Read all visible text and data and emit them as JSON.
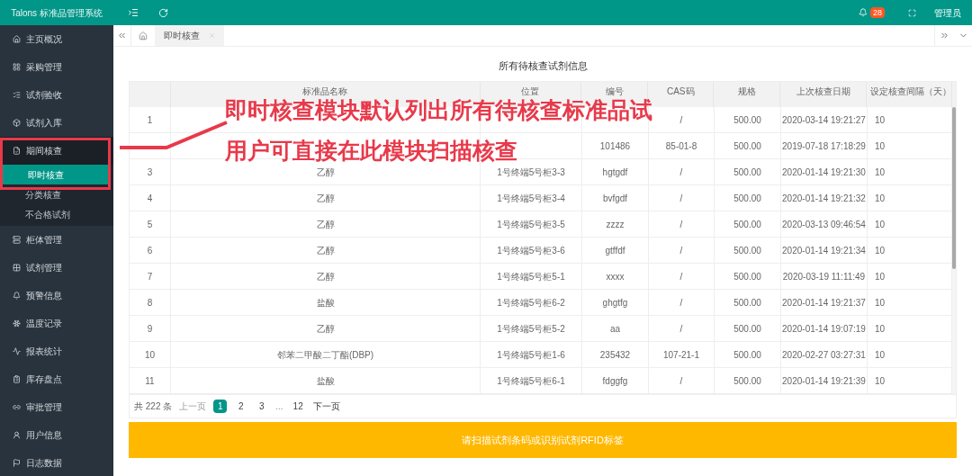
{
  "app_title": "Talons 标准品管理系统",
  "notifications": {
    "count": "28"
  },
  "user": "管理员",
  "sidebar": {
    "items": [
      {
        "label": "主页概况",
        "expanded": false
      },
      {
        "label": "采购管理",
        "expanded": false
      },
      {
        "label": "试剂验收",
        "expanded": false
      },
      {
        "label": "试剂入库",
        "expanded": false
      },
      {
        "label": "期间核查",
        "expanded": true,
        "children": [
          {
            "label": "即时核查",
            "selected": true
          },
          {
            "label": "分类核查",
            "selected": false
          },
          {
            "label": "不合格试剂",
            "selected": false
          }
        ]
      },
      {
        "label": "柜体管理",
        "expanded": false
      },
      {
        "label": "试剂管理",
        "expanded": false
      },
      {
        "label": "预警信息",
        "expanded": false
      },
      {
        "label": "温度记录",
        "expanded": false
      },
      {
        "label": "报表统计",
        "expanded": false
      },
      {
        "label": "库存盘点",
        "expanded": false
      },
      {
        "label": "审批管理",
        "expanded": false
      },
      {
        "label": "用户信息",
        "expanded": false
      },
      {
        "label": "日志数据",
        "expanded": false
      }
    ]
  },
  "tabs": [
    {
      "label": "即时核查",
      "selected": true
    }
  ],
  "page_title": "所有待核查试剂信息",
  "table": {
    "columns": [
      null,
      "标准品名称",
      "位置",
      "编号",
      "CAS码",
      "规格",
      "上次核查日期",
      "设定核查间隔（天）"
    ],
    "rows": [
      [
        "1",
        null,
        null,
        null,
        "/",
        "500.00",
        "2020-03-14 19:21:27",
        "10"
      ],
      [
        null,
        null,
        null,
        "101486",
        "85-01-8",
        "500.00",
        "2019-07-18 17:18:29",
        "10"
      ],
      [
        "3",
        "乙醇",
        "1号终端5号柜3-3",
        "hgtgdf",
        "/",
        "500.00",
        "2020-01-14 19:21:30",
        "10"
      ],
      [
        "4",
        "乙醇",
        "1号终端5号柜3-4",
        "bvfgdf",
        "/",
        "500.00",
        "2020-01-14 19:21:32",
        "10"
      ],
      [
        "5",
        "乙醇",
        "1号终端5号柜3-5",
        "zzzz",
        "/",
        "500.00",
        "2020-03-13 09:46:54",
        "10"
      ],
      [
        "6",
        "乙醇",
        "1号终端5号柜3-6",
        "gtffdf",
        "/",
        "500.00",
        "2020-01-14 19:21:34",
        "10"
      ],
      [
        "7",
        "乙醇",
        "1号终端5号柜5-1",
        "xxxx",
        "/",
        "500.00",
        "2020-03-19 11:11:49",
        "10"
      ],
      [
        "8",
        "盐酸",
        "1号终端5号柜6-2",
        "ghgtfg",
        "/",
        "500.00",
        "2020-01-14 19:21:37",
        "10"
      ],
      [
        "9",
        "乙醇",
        "1号终端5号柜5-2",
        "aa",
        "/",
        "500.00",
        "2020-01-14 19:07:19",
        "10"
      ],
      [
        "10",
        "邻苯二甲酸二丁酯(DBP)",
        "1号终端5号柜1-6",
        "235432",
        "107-21-1",
        "500.00",
        "2020-02-27 03:27:31",
        "10"
      ],
      [
        "11",
        "盐酸",
        "1号终端5号柜6-1",
        "fdggfg",
        "/",
        "500.00",
        "2020-01-14 19:21:39",
        "10"
      ]
    ]
  },
  "pagination": {
    "total": "共 222 条",
    "prev": {
      "label": "上一页",
      "disabled": true
    },
    "pages": [
      {
        "kind": "page",
        "label": "1",
        "selected": true
      },
      {
        "kind": "page",
        "label": "2",
        "selected": false
      },
      {
        "kind": "page",
        "label": "3",
        "selected": false
      },
      {
        "kind": "ellipsis",
        "label": "..."
      },
      {
        "kind": "page",
        "label": "12",
        "selected": false
      }
    ],
    "next": {
      "label": "下一页",
      "disabled": false
    }
  },
  "scan_button": "请扫描试剂条码或识别试剂RFID标签",
  "annotation": {
    "lines": [
      "即时核查模块默认列出所有待核查标准品试",
      "用户可直接在此模块扫描核查"
    ]
  }
}
